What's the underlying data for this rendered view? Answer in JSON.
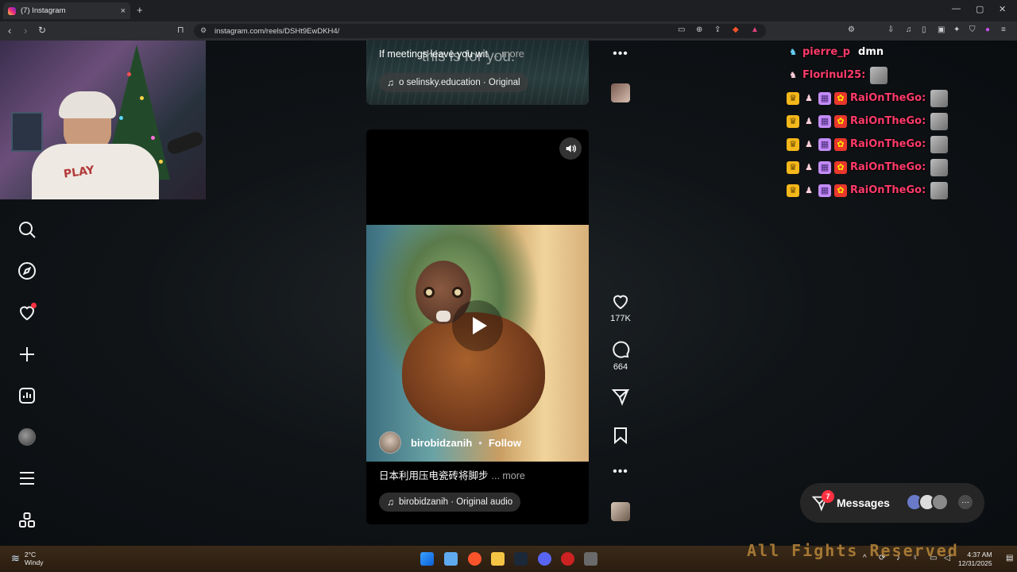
{
  "browser": {
    "tab_title": "(7) Instagram",
    "tab_close": "×",
    "new_tab": "+",
    "window_controls": [
      "—",
      "▢",
      "✕"
    ],
    "url": "instagram.com/reels/DSHt9EwDKH4/"
  },
  "reel_prev": {
    "caption": "If meetings leave you wit",
    "caption_more": "... more",
    "overlay_text": "this is for you.",
    "audio": "o   selinsky.education · Original"
  },
  "reel_main": {
    "author": "birobidzanih",
    "follow": "Follow",
    "separator": "•",
    "caption": "日本利用压电瓷砖将脚步",
    "caption_more": "... more",
    "audio": "birobidzanih · Original audio",
    "likes": "177K",
    "comments": "664"
  },
  "chat": {
    "lines": [
      {
        "user": "pierre_p",
        "message": "dmn"
      },
      {
        "user": "Florinul25:",
        "message": ""
      },
      {
        "user": "RaiOnTheGo:",
        "message": ""
      },
      {
        "user": "RaiOnTheGo:",
        "message": ""
      },
      {
        "user": "RaiOnTheGo:",
        "message": ""
      },
      {
        "user": "RaiOnTheGo:",
        "message": ""
      },
      {
        "user": "RaiOnTheGo:",
        "message": ""
      }
    ]
  },
  "messages": {
    "label": "Messages",
    "count": "7",
    "more": "···"
  },
  "taskbar": {
    "temp": "2°C",
    "condition": "Windy",
    "banner": "All Fights Reserved",
    "time": "4:37 AM",
    "date": "12/31/2025"
  },
  "icons": {
    "search": "search-icon",
    "explore": "explore-icon",
    "notifications": "heart-icon",
    "create": "plus-icon",
    "dashboard": "insights-icon",
    "menu": "hamburger-icon",
    "more": "apps-icon"
  }
}
